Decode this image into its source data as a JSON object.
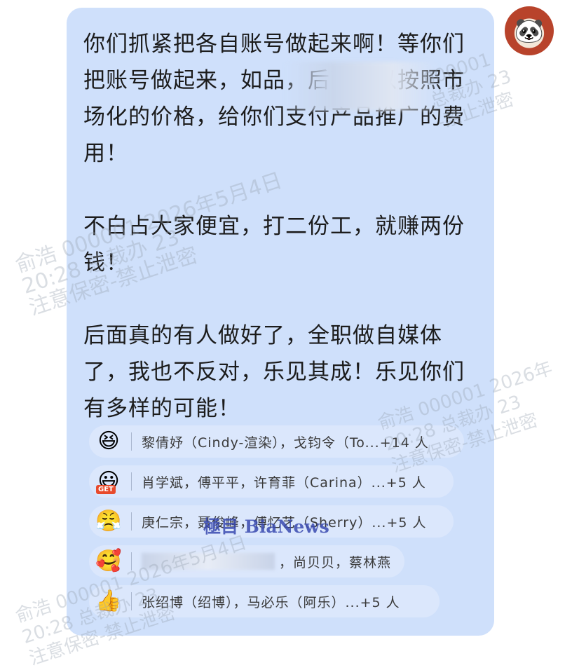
{
  "message": {
    "paragraph1_a": "你们抓紧把各自账号做起来啊！等你们把账号做起来，如",
    "paragraph1_b": "品，后面可以按照市场化的价格，给你们支付产品推广的费用！",
    "paragraph2": "不白占大家便宜，打二份工，就赚两份钱！",
    "paragraph3": "后面真的有人做好了，全职做自媒体了，我也不反对，乐见其成！乐见你们有多样的可能！"
  },
  "reactions": [
    {
      "icon": "laughing-face-emoji",
      "glyph": "😆",
      "text": "黎倩妤（Cindy-渲染），戈钧令（To...+14 人"
    },
    {
      "icon": "get-face-emoji",
      "glyph": "😃",
      "badge": "GET",
      "text": "肖学斌，傅平平，许育菲（Carina）...+5 人"
    },
    {
      "icon": "headband-face-emoji",
      "glyph": "😤",
      "text": "庚仁宗，聂俊峰，傅忆艺（Sherry）...+5 人"
    },
    {
      "icon": "heart-face-emoji",
      "glyph": "🥰",
      "text": "，尚贝贝，蔡林燕"
    },
    {
      "icon": "thumbs-up-emoji",
      "glyph": "👍",
      "text": "张绍博（绍博），马必乐（阿乐）...+5 人"
    }
  ],
  "avatar": {
    "glyph": "🐼"
  },
  "watermarks": [
    {
      "line1": "俞浩 000001 2026年5月4日",
      "line2": "20:28 总裁办 23",
      "line3": "注意保密-禁止泄密"
    },
    {
      "line1": "000001",
      "line2": "总裁办 23",
      "line3": "-禁止泄密"
    },
    {
      "line1": "俞浩 000001 2026年",
      "line2": "20:28 总裁办 23",
      "line3": "注意保密-禁止泄密"
    }
  ],
  "brand_watermark": "極目 BiaNews"
}
